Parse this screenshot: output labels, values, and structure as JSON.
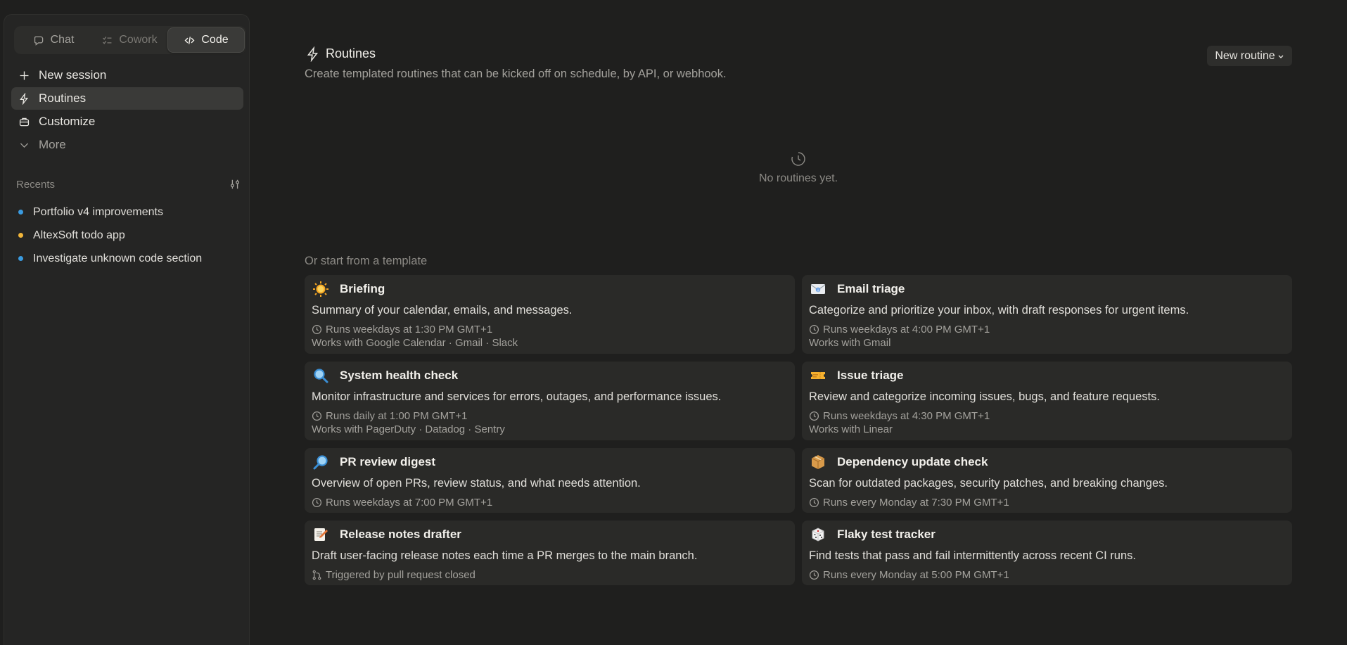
{
  "sidebar": {
    "modes": [
      {
        "label": "Chat",
        "icon": "chat-icon"
      },
      {
        "label": "Cowork",
        "icon": "cowork-icon"
      },
      {
        "label": "Code",
        "icon": "code-icon"
      }
    ],
    "nav": [
      {
        "label": "New session",
        "icon": "plus-icon"
      },
      {
        "label": "Routines",
        "icon": "lightning-icon"
      },
      {
        "label": "Customize",
        "icon": "briefcase-icon"
      },
      {
        "label": "More",
        "icon": "chevron-down-icon"
      }
    ],
    "recents_label": "Recents",
    "recents": [
      {
        "label": "Portfolio v4 improvements",
        "dot": "#3a9be0"
      },
      {
        "label": "AltexSoft todo app",
        "dot": "#f2b63a"
      },
      {
        "label": "Investigate unknown code section",
        "dot": "#3a9be0"
      }
    ]
  },
  "main": {
    "title": "Routines",
    "subtitle": "Create templated routines that can be kicked off on schedule, by API, or webhook.",
    "new_routine_label": "New routine",
    "empty_text": "No routines yet.",
    "template_label": "Or start from a template",
    "templates": [
      {
        "title": "Briefing",
        "emoji": "sun-icon",
        "desc": "Summary of your calendar, emails, and messages.",
        "schedule": "Runs weekdays at 1:30 PM GMT+1",
        "works": "Works with Google Calendar · Gmail · Slack",
        "meta_icon": "clock-icon"
      },
      {
        "title": "Email triage",
        "emoji": "email-icon",
        "desc": "Categorize and prioritize your inbox, with draft responses for urgent items.",
        "schedule": "Runs weekdays at 4:00 PM GMT+1",
        "works": "Works with Gmail",
        "meta_icon": "clock-icon"
      },
      {
        "title": "System health check",
        "emoji": "magnifier-icon",
        "desc": "Monitor infrastructure and services for errors, outages, and performance issues.",
        "schedule": "Runs daily at 1:00 PM GMT+1",
        "works": "Works with PagerDuty · Datadog · Sentry",
        "meta_icon": "clock-icon"
      },
      {
        "title": "Issue triage",
        "emoji": "ticket-icon",
        "desc": "Review and categorize incoming issues, bugs, and feature requests.",
        "schedule": "Runs weekdays at 4:30 PM GMT+1",
        "works": "Works with Linear",
        "meta_icon": "clock-icon"
      },
      {
        "title": "PR review digest",
        "emoji": "magnifier-right-icon",
        "desc": "Overview of open PRs, review status, and what needs attention.",
        "schedule": "Runs weekdays at 7:00 PM GMT+1",
        "works": "",
        "meta_icon": "clock-icon"
      },
      {
        "title": "Dependency update check",
        "emoji": "package-icon",
        "desc": "Scan for outdated packages, security patches, and breaking changes.",
        "schedule": "Runs every Monday at 7:30 PM GMT+1",
        "works": "",
        "meta_icon": "clock-icon"
      },
      {
        "title": "Release notes drafter",
        "emoji": "memo-icon",
        "desc": "Draft user-facing release notes each time a PR merges to the main branch.",
        "schedule": "Triggered by pull request closed",
        "works": "",
        "meta_icon": "git-branch-icon"
      },
      {
        "title": "Flaky test tracker",
        "emoji": "dice-icon",
        "desc": "Find tests that pass and fail intermittently across recent CI runs.",
        "schedule": "Runs every Monday at 5:00 PM GMT+1",
        "works": "",
        "meta_icon": "clock-icon"
      }
    ]
  }
}
